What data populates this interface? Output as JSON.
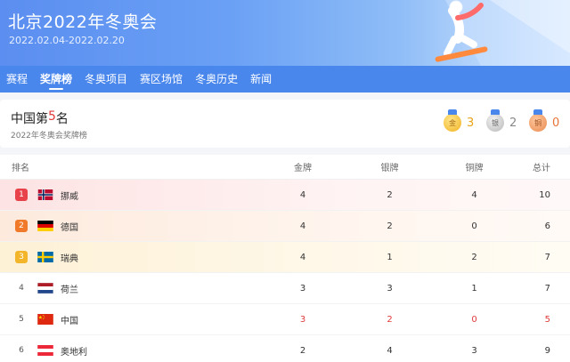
{
  "header": {
    "title": "北京2022年冬奥会",
    "dates": "2022.02.04-2022.02.20"
  },
  "nav": {
    "tabs": [
      {
        "label": "赛程"
      },
      {
        "label": "奖牌榜"
      },
      {
        "label": "冬奥项目"
      },
      {
        "label": "赛区场馆"
      },
      {
        "label": "冬奥历史"
      },
      {
        "label": "新闻"
      }
    ],
    "active": "奖牌榜"
  },
  "summary": {
    "prefix": "中国第",
    "rank": "5",
    "suffix": "名",
    "subtitle": "2022年冬奥会奖牌榜",
    "gold_icon_text": "金",
    "silver_icon_text": "银",
    "bronze_icon_text": "铜",
    "gold": "3",
    "silver": "2",
    "bronze": "0"
  },
  "table": {
    "headers": {
      "rank": "排名",
      "gold": "金牌",
      "silver": "银牌",
      "bronze": "铜牌",
      "total": "总计"
    },
    "rows": [
      {
        "rank": "1",
        "country": "挪威",
        "gold": "4",
        "silver": "2",
        "bronze": "4",
        "total": "10"
      },
      {
        "rank": "2",
        "country": "德国",
        "gold": "4",
        "silver": "2",
        "bronze": "0",
        "total": "6"
      },
      {
        "rank": "3",
        "country": "瑞典",
        "gold": "4",
        "silver": "1",
        "bronze": "2",
        "total": "7"
      },
      {
        "rank": "4",
        "country": "荷兰",
        "gold": "3",
        "silver": "3",
        "bronze": "1",
        "total": "7"
      },
      {
        "rank": "5",
        "country": "中国",
        "gold": "3",
        "silver": "2",
        "bronze": "0",
        "total": "5"
      },
      {
        "rank": "6",
        "country": "奥地利",
        "gold": "2",
        "silver": "4",
        "bronze": "3",
        "total": "9"
      }
    ]
  },
  "colors": {
    "nav_bg": "#4a87ec",
    "highlight": "#e03b3b",
    "rank1": "#e8434a",
    "rank2": "#f07a2a",
    "rank3": "#f3b52a"
  }
}
